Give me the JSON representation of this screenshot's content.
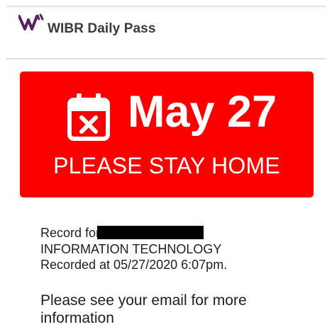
{
  "app": {
    "title": "WIBR Daily Pass",
    "logo_icon": "wibr-logo-icon",
    "logo_color": "#5b1f66"
  },
  "pass": {
    "date": "May 27",
    "status": "PLEASE STAY HOME",
    "icon": "calendar-x-icon",
    "banner_color": "#fc0000"
  },
  "record": {
    "record_for_label": "Record for",
    "department": "INFORMATION TECHNOLOGY",
    "recorded_at": "Recorded at 05/27/2020 6:07pm."
  },
  "note": {
    "text": "Please see your email for more information"
  }
}
